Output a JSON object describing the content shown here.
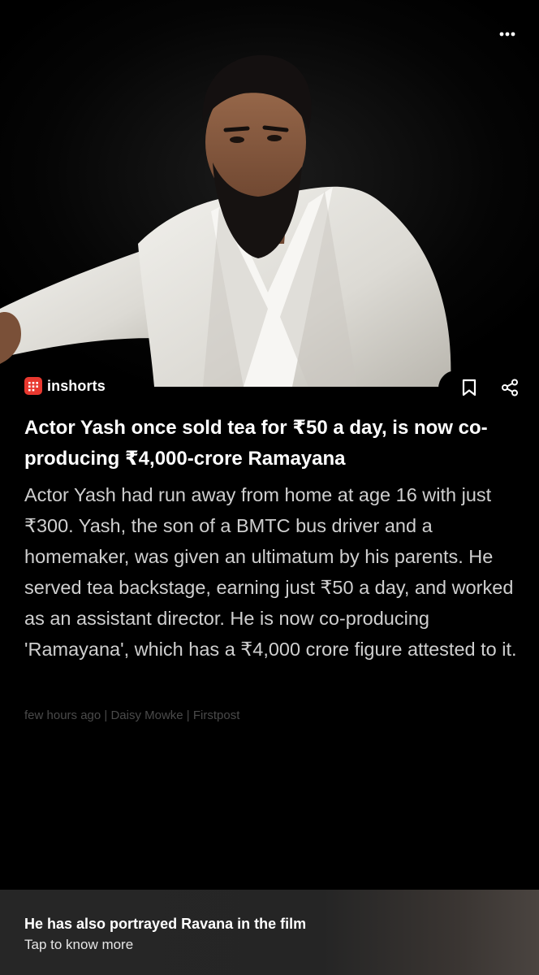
{
  "hero": {
    "image_description": "Portrait of a bearded man in a white suit against a dark background"
  },
  "menu": {
    "icon": "more-horizontal-icon"
  },
  "brand": {
    "name": "inshorts",
    "logo_color": "#e8382f"
  },
  "actions": {
    "bookmark_icon": "bookmark-icon",
    "share_icon": "share-icon"
  },
  "article": {
    "headline": "Actor Yash once sold tea for ₹50 a day, is now co-producing ₹4,000-crore Ramayana",
    "body": "Actor Yash had run away from home at age 16 with just ₹300. Yash, the son of a BMTC bus driver and a homemaker, was given an ultimatum by his parents. He served tea backstage, earning just ₹50 a day, and worked as an assistant director. He is now co-producing 'Ramayana', which has a ₹4,000 crore figure attested to it.",
    "byline": "few hours ago | Daisy Mowke | Firstpost"
  },
  "footer": {
    "title": "He has also portrayed Ravana in the film",
    "subtitle": "Tap to know more"
  },
  "colors": {
    "background": "#000000",
    "headline": "#ffffff",
    "body": "#cfcfcf",
    "byline": "#4a4a4a",
    "footer_bg": "#262626"
  }
}
